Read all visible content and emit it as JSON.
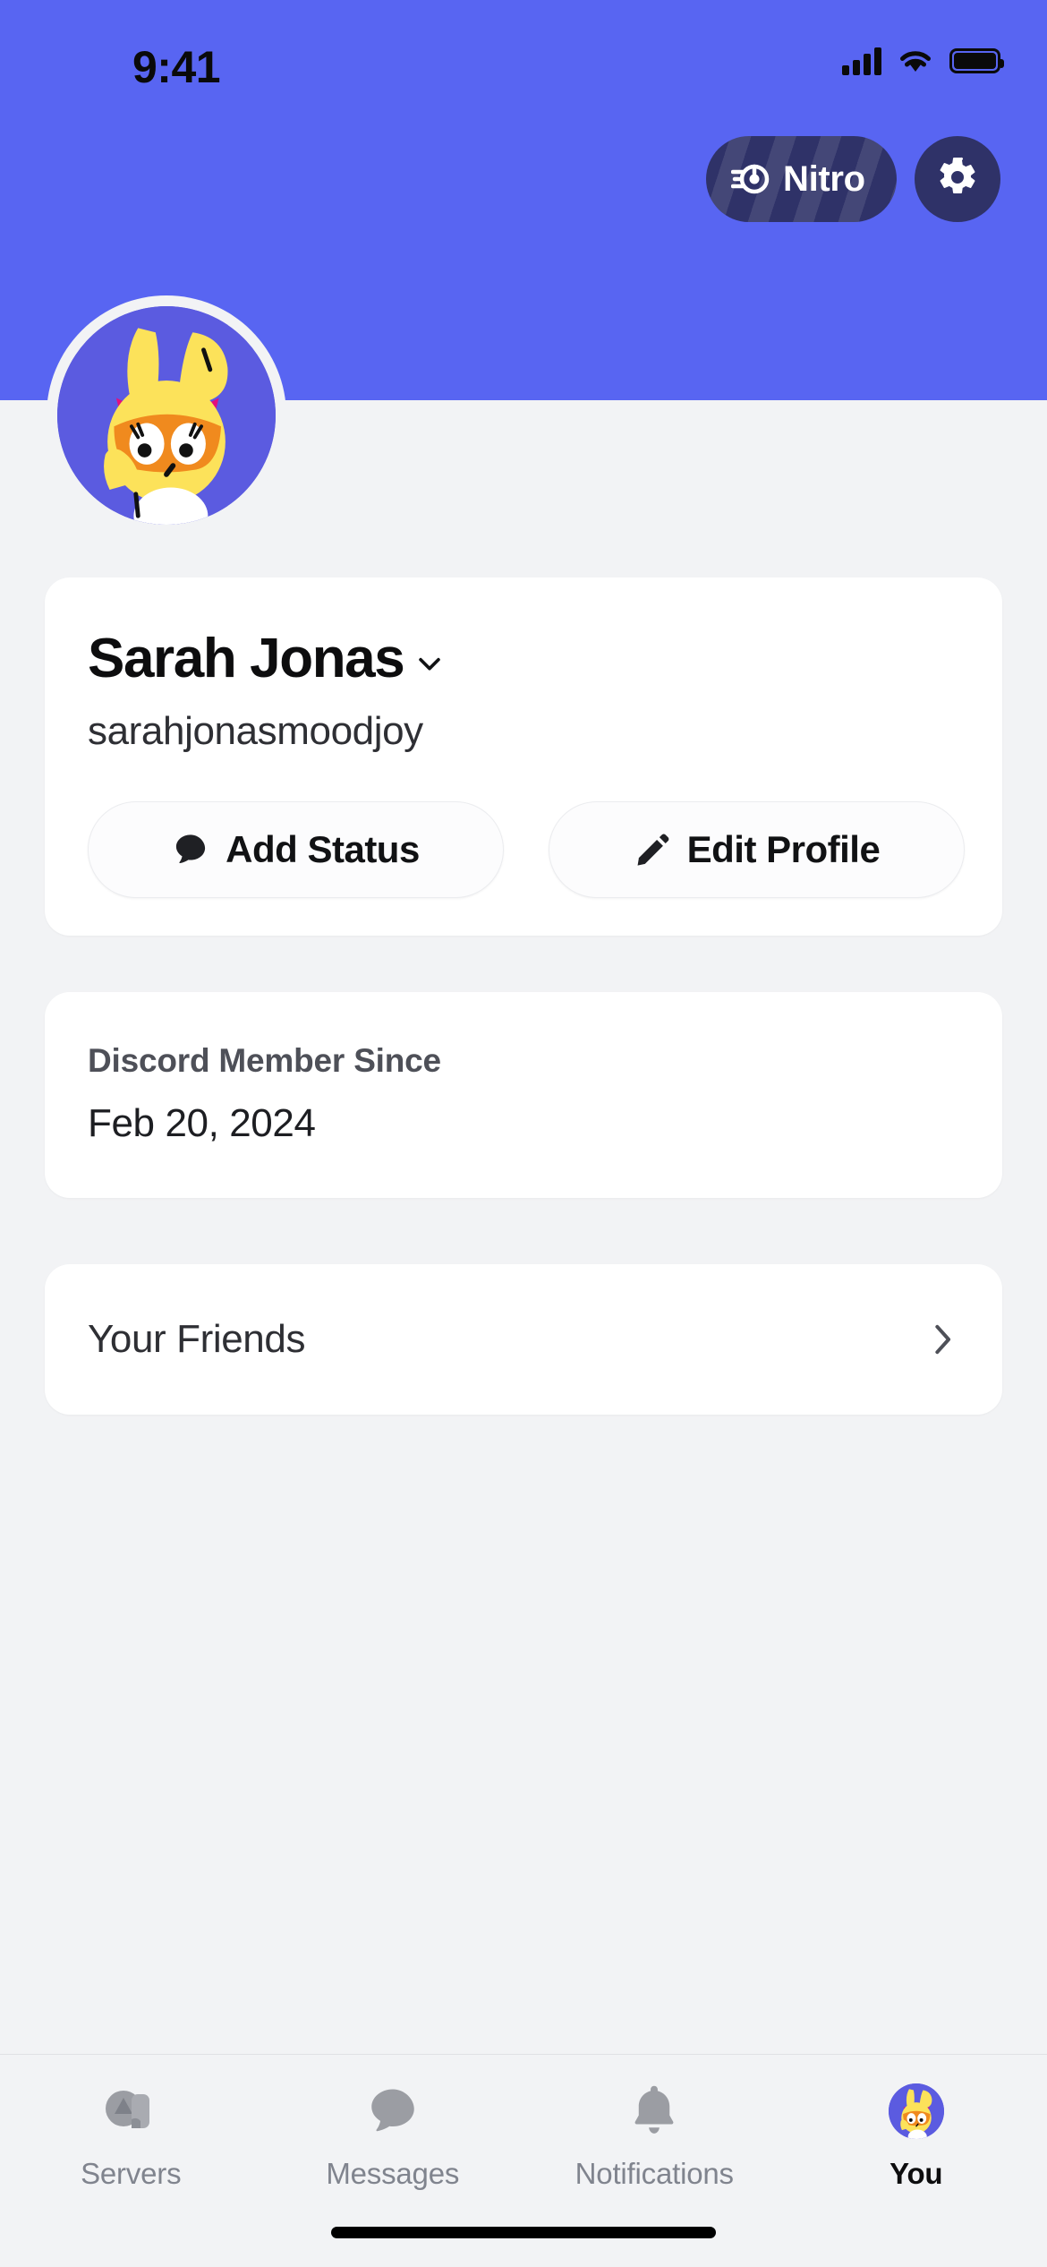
{
  "status_bar": {
    "time": "9:41",
    "signal_icon": "cellular-signal-icon",
    "wifi_icon": "wifi-icon",
    "battery_icon": "battery-icon"
  },
  "header": {
    "banner_color": "#5865F2",
    "nitro": {
      "label": "Nitro",
      "icon": "nitro-boost-icon",
      "background": "#2F3268"
    },
    "settings": {
      "icon": "gear-icon",
      "background": "#2F3268"
    }
  },
  "avatar": {
    "icon": "user-avatar",
    "background": "#5B5BE0"
  },
  "profile": {
    "display_name": "Sarah Jonas",
    "chevron_icon": "chevron-down-icon",
    "username": "sarahjonasmoodjoy",
    "actions": [
      {
        "label": "Add Status",
        "icon": "speech-bubble-icon"
      },
      {
        "label": "Edit Profile",
        "icon": "pencil-icon"
      }
    ]
  },
  "member_since": {
    "label": "Discord Member Since",
    "date": "Feb 20, 2024"
  },
  "friends": {
    "label": "Your Friends",
    "chevron_icon": "chevron-right-icon"
  },
  "tabbar": {
    "items": [
      {
        "label": "Servers",
        "icon": "servers-icon",
        "active": false
      },
      {
        "label": "Messages",
        "icon": "speech-bubble-icon",
        "active": false
      },
      {
        "label": "Notifications",
        "icon": "bell-icon",
        "active": false
      },
      {
        "label": "You",
        "icon": "user-avatar",
        "active": true
      }
    ]
  },
  "colors": {
    "page_background": "#F2F3F5",
    "card_background": "#FFFFFF",
    "accent": "#5865F2",
    "muted_text": "#80848E"
  }
}
